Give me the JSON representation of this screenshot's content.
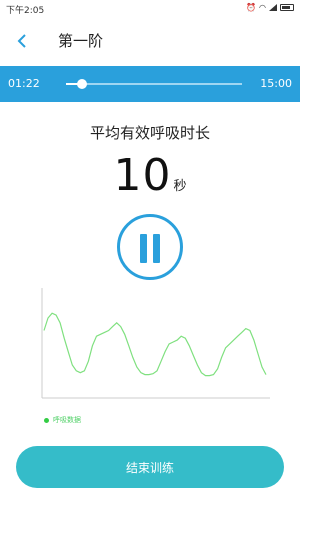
{
  "status_bar": {
    "time": "下午2:05"
  },
  "nav": {
    "title": "第一阶"
  },
  "playback": {
    "current_time": "01:22",
    "total_time": "15:00",
    "progress_fraction": 0.09
  },
  "metric": {
    "label": "平均有效呼吸时长",
    "value": "10",
    "unit": "秒"
  },
  "chart_data": {
    "type": "line",
    "series": [
      {
        "name": "呼吸数据",
        "values": [
          62,
          75,
          80,
          78,
          70,
          54,
          40,
          26,
          20,
          18,
          20,
          30,
          46,
          56,
          58,
          60,
          62,
          66,
          70,
          66,
          58,
          46,
          34,
          24,
          18,
          16,
          16,
          17,
          20,
          30,
          40,
          48,
          50,
          52,
          56,
          54,
          46,
          36,
          26,
          18,
          15,
          15,
          16,
          22,
          34,
          44,
          48,
          52,
          56,
          60,
          64,
          62,
          52,
          38,
          24,
          16
        ]
      }
    ],
    "colors": {
      "line": "#7fe07f"
    }
  },
  "end_button": {
    "label": "结束训练"
  },
  "colors": {
    "accent": "#2aa0dc",
    "button": "#35bcc9"
  }
}
